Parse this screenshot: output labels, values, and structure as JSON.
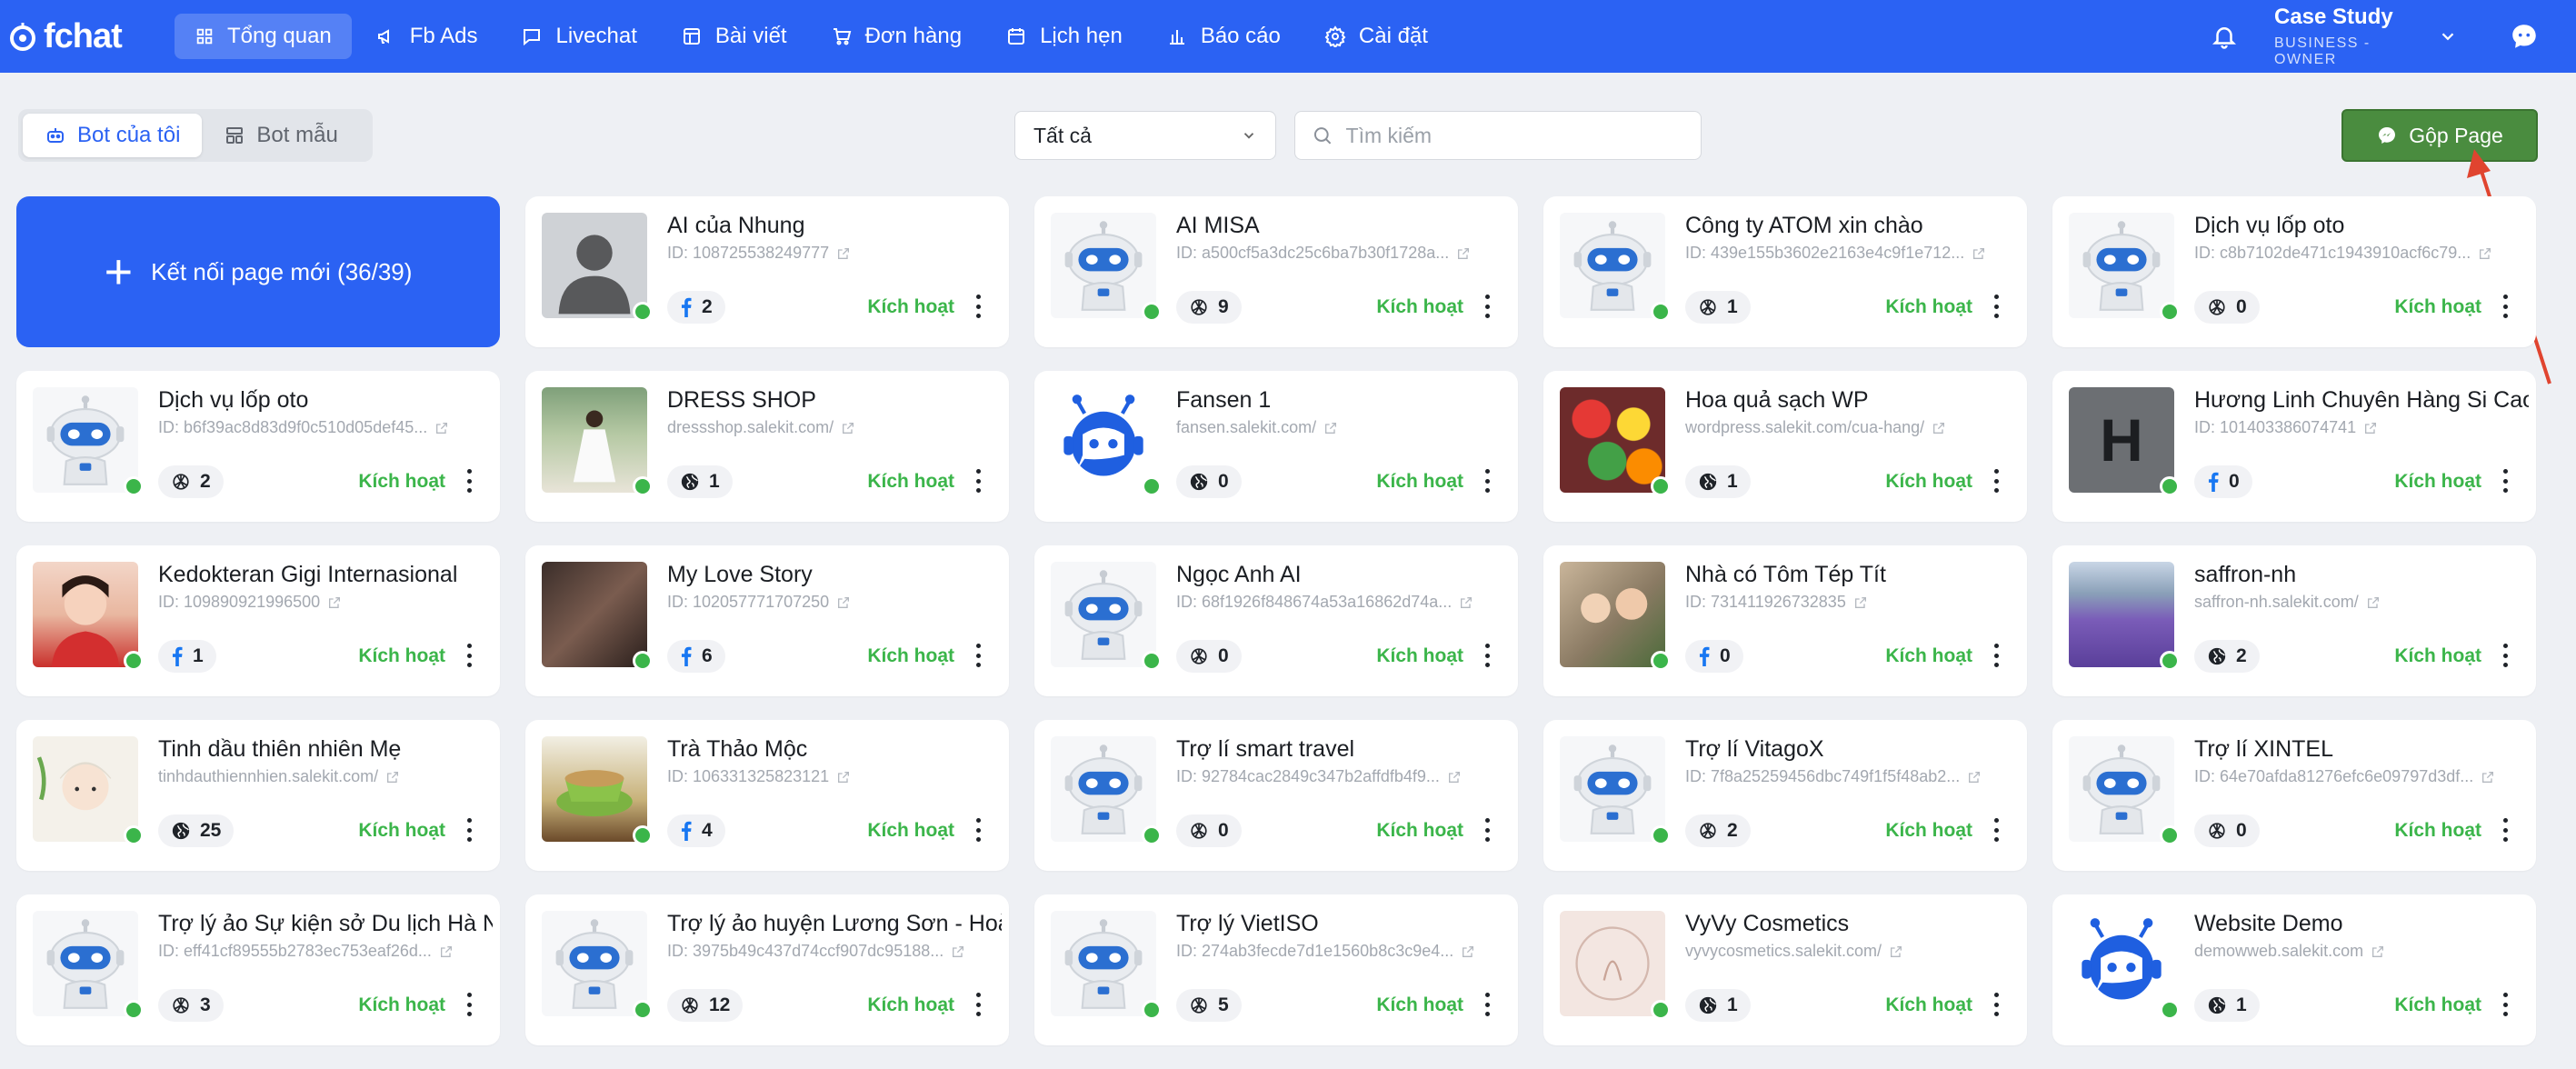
{
  "brand": {
    "name": "fchat",
    "primary": "#2b62f3",
    "success": "#3bb54a",
    "merge_color": "#4a8c3f"
  },
  "nav": [
    {
      "label": "Tổng quan",
      "icon": "grid-icon",
      "active": true
    },
    {
      "label": "Fb Ads",
      "icon": "megaphone-icon"
    },
    {
      "label": "Livechat",
      "icon": "chat-icon"
    },
    {
      "label": "Bài viết",
      "icon": "article-icon"
    },
    {
      "label": "Đơn hàng",
      "icon": "cart-icon"
    },
    {
      "label": "Lịch hẹn",
      "icon": "calendar-icon"
    },
    {
      "label": "Báo cáo",
      "icon": "bar-chart-icon"
    },
    {
      "label": "Cài đặt",
      "icon": "gear-icon"
    }
  ],
  "user": {
    "name": "Case Study",
    "role": "BUSINESS - OWNER"
  },
  "toolbar": {
    "tabs": [
      {
        "label": "Bot của tôi",
        "active": true
      },
      {
        "label": "Bot mẫu"
      }
    ],
    "filter_value": "Tất cả",
    "search_placeholder": "Tìm kiếm",
    "merge_label": "Gộp Page"
  },
  "connect_label": "Kết nối page mới (36/39)",
  "activate_label": "Kích hoạt",
  "cards": [
    {
      "name": "AI của Nhung",
      "sub": "ID: 108725538249777",
      "channel": "facebook",
      "count": "2",
      "avatar": "person"
    },
    {
      "name": "AI MISA",
      "sub": "ID: a500cf5a3dc25c6ba7b30f1728a...",
      "channel": "openai",
      "count": "9",
      "avatar": "robot"
    },
    {
      "name": "Công ty ATOM xin chào",
      "sub": "ID: 439e155b3602e2163e4c9f1e712...",
      "channel": "openai",
      "count": "1",
      "avatar": "robot"
    },
    {
      "name": "Dịch vụ lốp oto",
      "sub": "ID: c8b7102de471c1943910acf6c79...",
      "channel": "openai",
      "count": "0",
      "avatar": "robot"
    },
    {
      "name": "Dịch vụ lốp oto",
      "sub": "ID: b6f39ac8d83d9f0c510d05def45...",
      "channel": "openai",
      "count": "2",
      "avatar": "robot"
    },
    {
      "name": "DRESS SHOP",
      "sub": "dressshop.salekit.com/",
      "channel": "web",
      "count": "1",
      "avatar": "photo-dress"
    },
    {
      "name": "Fansen 1",
      "sub": "fansen.salekit.com/",
      "channel": "web",
      "count": "0",
      "avatar": "bot-blue"
    },
    {
      "name": "Hoa quả sạch WP",
      "sub": "wordpress.salekit.com/cua-hang/",
      "channel": "web",
      "count": "1",
      "avatar": "photo-fruit"
    },
    {
      "name": "Hương Linh Chuyên Hàng Si Cao",
      "sub": "ID: 101403386074741",
      "channel": "facebook",
      "count": "0",
      "avatar": "letter-h"
    },
    {
      "name": "Kedokteran Gigi Internasional",
      "sub": "ID: 109890921996500",
      "channel": "facebook",
      "count": "1",
      "avatar": "photo-woman"
    },
    {
      "name": "My Love Story",
      "sub": "ID: 102057771707250",
      "channel": "facebook",
      "count": "6",
      "avatar": "photo-dark"
    },
    {
      "name": "Ngọc Anh AI",
      "sub": "ID: 68f1926f848674a53a16862d74a...",
      "channel": "openai",
      "count": "0",
      "avatar": "robot"
    },
    {
      "name": "Nhà có Tôm Tép Tít",
      "sub": "ID: 731411926732835",
      "channel": "facebook",
      "count": "0",
      "avatar": "photo-kids"
    },
    {
      "name": "saffron-nh",
      "sub": "saffron-nh.salekit.com/",
      "channel": "web",
      "count": "2",
      "avatar": "photo-field"
    },
    {
      "name": "Tinh dầu thiên nhiên Mẹ",
      "sub": "tinhdauthiennhien.salekit.com/",
      "channel": "web",
      "count": "25",
      "avatar": "photo-spa"
    },
    {
      "name": "Trà Thảo Mộc",
      "sub": "ID: 106331325823121",
      "channel": "facebook",
      "count": "4",
      "avatar": "photo-tea"
    },
    {
      "name": "Trợ lí smart travel",
      "sub": "ID: 92784cac2849c347b2affdfb4f9...",
      "channel": "openai",
      "count": "0",
      "avatar": "robot"
    },
    {
      "name": "Trợ lí VitagoX",
      "sub": "ID: 7f8a25259456dbc749f1f5f48ab2...",
      "channel": "openai",
      "count": "2",
      "avatar": "robot"
    },
    {
      "name": "Trợ lí XINTEL",
      "sub": "ID: 64e70afda81276efc6e09797d3df...",
      "channel": "openai",
      "count": "0",
      "avatar": "robot"
    },
    {
      "name": "Trợ lý ảo Sự kiện sở Du lịch Hà N",
      "sub": "ID: eff41cf89555b2783ec753eaf26d...",
      "channel": "openai",
      "count": "3",
      "avatar": "robot"
    },
    {
      "name": "Trợ lý ảo huyện Lương Sơn - Hoà",
      "sub": "ID: 3975b49c437d74ccf907dc95188...",
      "channel": "openai",
      "count": "12",
      "avatar": "robot"
    },
    {
      "name": "Trợ lý VietISO",
      "sub": "ID: 274ab3fecde7d1e1560b8c3c9e4...",
      "channel": "openai",
      "count": "5",
      "avatar": "robot"
    },
    {
      "name": "VyVy Cosmetics",
      "sub": "vyvycosmetics.salekit.com/",
      "channel": "web",
      "count": "1",
      "avatar": "photo-cosmetic"
    },
    {
      "name": "Website Demo",
      "sub": "demowweb.salekit.com",
      "channel": "web",
      "count": "1",
      "avatar": "bot-blue"
    }
  ]
}
